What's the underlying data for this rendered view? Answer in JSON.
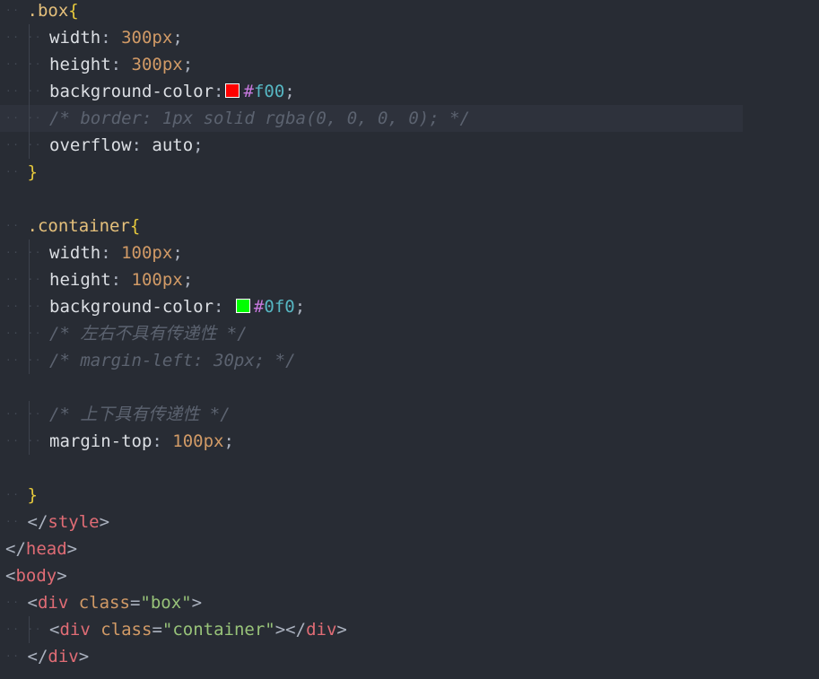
{
  "editor": {
    "lines": [
      {
        "indent": 1,
        "tokens": [
          [
            "sel",
            ".box"
          ],
          [
            "brace",
            "{"
          ]
        ]
      },
      {
        "indent": 2,
        "tokens": [
          [
            "prop",
            "width"
          ],
          [
            "punct",
            ": "
          ],
          [
            "num",
            "300"
          ],
          [
            "num",
            "px"
          ],
          [
            "punct",
            ";"
          ]
        ]
      },
      {
        "indent": 2,
        "tokens": [
          [
            "prop",
            "height"
          ],
          [
            "punct",
            ": "
          ],
          [
            "num",
            "300"
          ],
          [
            "num",
            "px"
          ],
          [
            "punct",
            ";"
          ]
        ]
      },
      {
        "indent": 2,
        "tokens": [
          [
            "prop",
            "background-color"
          ],
          [
            "punct",
            ":"
          ],
          [
            "swatch",
            "#ff0000"
          ],
          [
            "hash",
            "#"
          ],
          [
            "hex",
            "f00"
          ],
          [
            "punct",
            ";"
          ]
        ]
      },
      {
        "indent": 2,
        "current": true,
        "tokens": [
          [
            "comment",
            "/* border: 1px solid rgba(0, 0, 0, 0); */"
          ]
        ]
      },
      {
        "indent": 2,
        "tokens": [
          [
            "prop",
            "overflow"
          ],
          [
            "punct",
            ": "
          ],
          [
            "kw",
            "auto"
          ],
          [
            "punct",
            ";"
          ]
        ]
      },
      {
        "indent": 1,
        "tokens": [
          [
            "brace",
            "}"
          ]
        ]
      },
      {
        "indent": 0,
        "tokens": []
      },
      {
        "indent": 1,
        "tokens": [
          [
            "sel",
            ".container"
          ],
          [
            "brace",
            "{"
          ]
        ]
      },
      {
        "indent": 2,
        "tokens": [
          [
            "prop",
            "width"
          ],
          [
            "punct",
            ": "
          ],
          [
            "num",
            "100"
          ],
          [
            "num",
            "px"
          ],
          [
            "punct",
            ";"
          ]
        ]
      },
      {
        "indent": 2,
        "tokens": [
          [
            "prop",
            "height"
          ],
          [
            "punct",
            ": "
          ],
          [
            "num",
            "100"
          ],
          [
            "num",
            "px"
          ],
          [
            "punct",
            ";"
          ]
        ]
      },
      {
        "indent": 2,
        "tokens": [
          [
            "prop",
            "background-color"
          ],
          [
            "punct",
            ": "
          ],
          [
            "swatch",
            "#00ff00"
          ],
          [
            "hash",
            "#"
          ],
          [
            "hex",
            "0f0"
          ],
          [
            "punct",
            ";"
          ]
        ]
      },
      {
        "indent": 2,
        "tokens": [
          [
            "comment",
            "/* 左右不具有传递性 */"
          ]
        ]
      },
      {
        "indent": 2,
        "tokens": [
          [
            "comment",
            "/* margin-left: 30px; */"
          ]
        ]
      },
      {
        "indent": 0,
        "tokens": []
      },
      {
        "indent": 2,
        "tokens": [
          [
            "comment",
            "/* 上下具有传递性 */"
          ]
        ]
      },
      {
        "indent": 2,
        "tokens": [
          [
            "prop",
            "margin-top"
          ],
          [
            "punct",
            ": "
          ],
          [
            "num",
            "100"
          ],
          [
            "num",
            "px"
          ],
          [
            "punct",
            ";"
          ]
        ]
      },
      {
        "indent": 0,
        "tokens": []
      },
      {
        "indent": 1,
        "tokens": [
          [
            "brace",
            "}"
          ]
        ]
      },
      {
        "indent": 1,
        "tokens": [
          [
            "punct",
            "</"
          ],
          [
            "tag",
            "style"
          ],
          [
            "punct",
            ">"
          ]
        ]
      },
      {
        "indent": 0,
        "tokens": [
          [
            "punct",
            "</"
          ],
          [
            "tag",
            "head"
          ],
          [
            "punct",
            ">"
          ]
        ]
      },
      {
        "indent": 0,
        "tokens": [
          [
            "punct",
            "<"
          ],
          [
            "tag",
            "body"
          ],
          [
            "punct",
            ">"
          ]
        ]
      },
      {
        "indent": 1,
        "tokens": [
          [
            "punct",
            "<"
          ],
          [
            "tag",
            "div"
          ],
          [
            "punct",
            " "
          ],
          [
            "attr",
            "class"
          ],
          [
            "punct",
            "="
          ],
          [
            "str",
            "\"box\""
          ],
          [
            "punct",
            ">"
          ]
        ]
      },
      {
        "indent": 2,
        "tokens": [
          [
            "punct",
            "<"
          ],
          [
            "tag",
            "div"
          ],
          [
            "punct",
            " "
          ],
          [
            "attr",
            "class"
          ],
          [
            "punct",
            "="
          ],
          [
            "str",
            "\"container\""
          ],
          [
            "punct",
            "></"
          ],
          [
            "tag",
            "div"
          ],
          [
            "punct",
            ">"
          ]
        ]
      },
      {
        "indent": 1,
        "tokens": [
          [
            "punct",
            "</"
          ],
          [
            "tag",
            "div"
          ],
          [
            "punct",
            ">"
          ]
        ]
      }
    ]
  }
}
